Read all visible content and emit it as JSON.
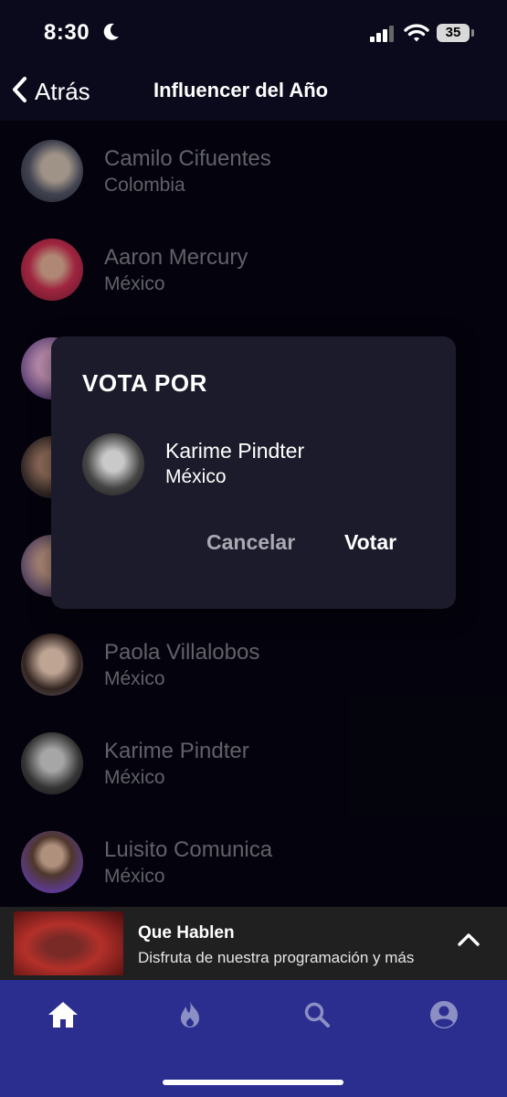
{
  "status_bar": {
    "time": "8:30",
    "battery": "35"
  },
  "nav": {
    "back_label": "Atrás",
    "title": "Influencer del Año"
  },
  "list": {
    "items": [
      {
        "name": "Camilo Cifuentes",
        "country": "Colombia"
      },
      {
        "name": "Aaron Mercury",
        "country": "México"
      },
      {
        "name": "",
        "country": ""
      },
      {
        "name": "",
        "country": ""
      },
      {
        "name": "",
        "country": ""
      },
      {
        "name": "Paola Villalobos",
        "country": "México"
      },
      {
        "name": "Karime Pindter",
        "country": "México"
      },
      {
        "name": "Luisito Comunica",
        "country": "México"
      }
    ]
  },
  "dialog": {
    "title": "VOTA POR",
    "name": "Karime Pindter",
    "country": "México",
    "cancel_label": "Cancelar",
    "vote_label": "Votar"
  },
  "mini_player": {
    "title": "Que Hablen",
    "subtitle": "Disfruta de nuestra programación y más"
  },
  "tabs": [
    {
      "icon": "home-icon",
      "active": true
    },
    {
      "icon": "flame-icon",
      "active": false
    },
    {
      "icon": "search-icon",
      "active": false
    },
    {
      "icon": "account-icon",
      "active": false
    }
  ],
  "colors": {
    "background": "#05040f",
    "header": "#0b0a1d",
    "dialog": "#1b1b2b",
    "tab_bar": "#2b2e8f",
    "muted_text": "#6f6f78"
  }
}
